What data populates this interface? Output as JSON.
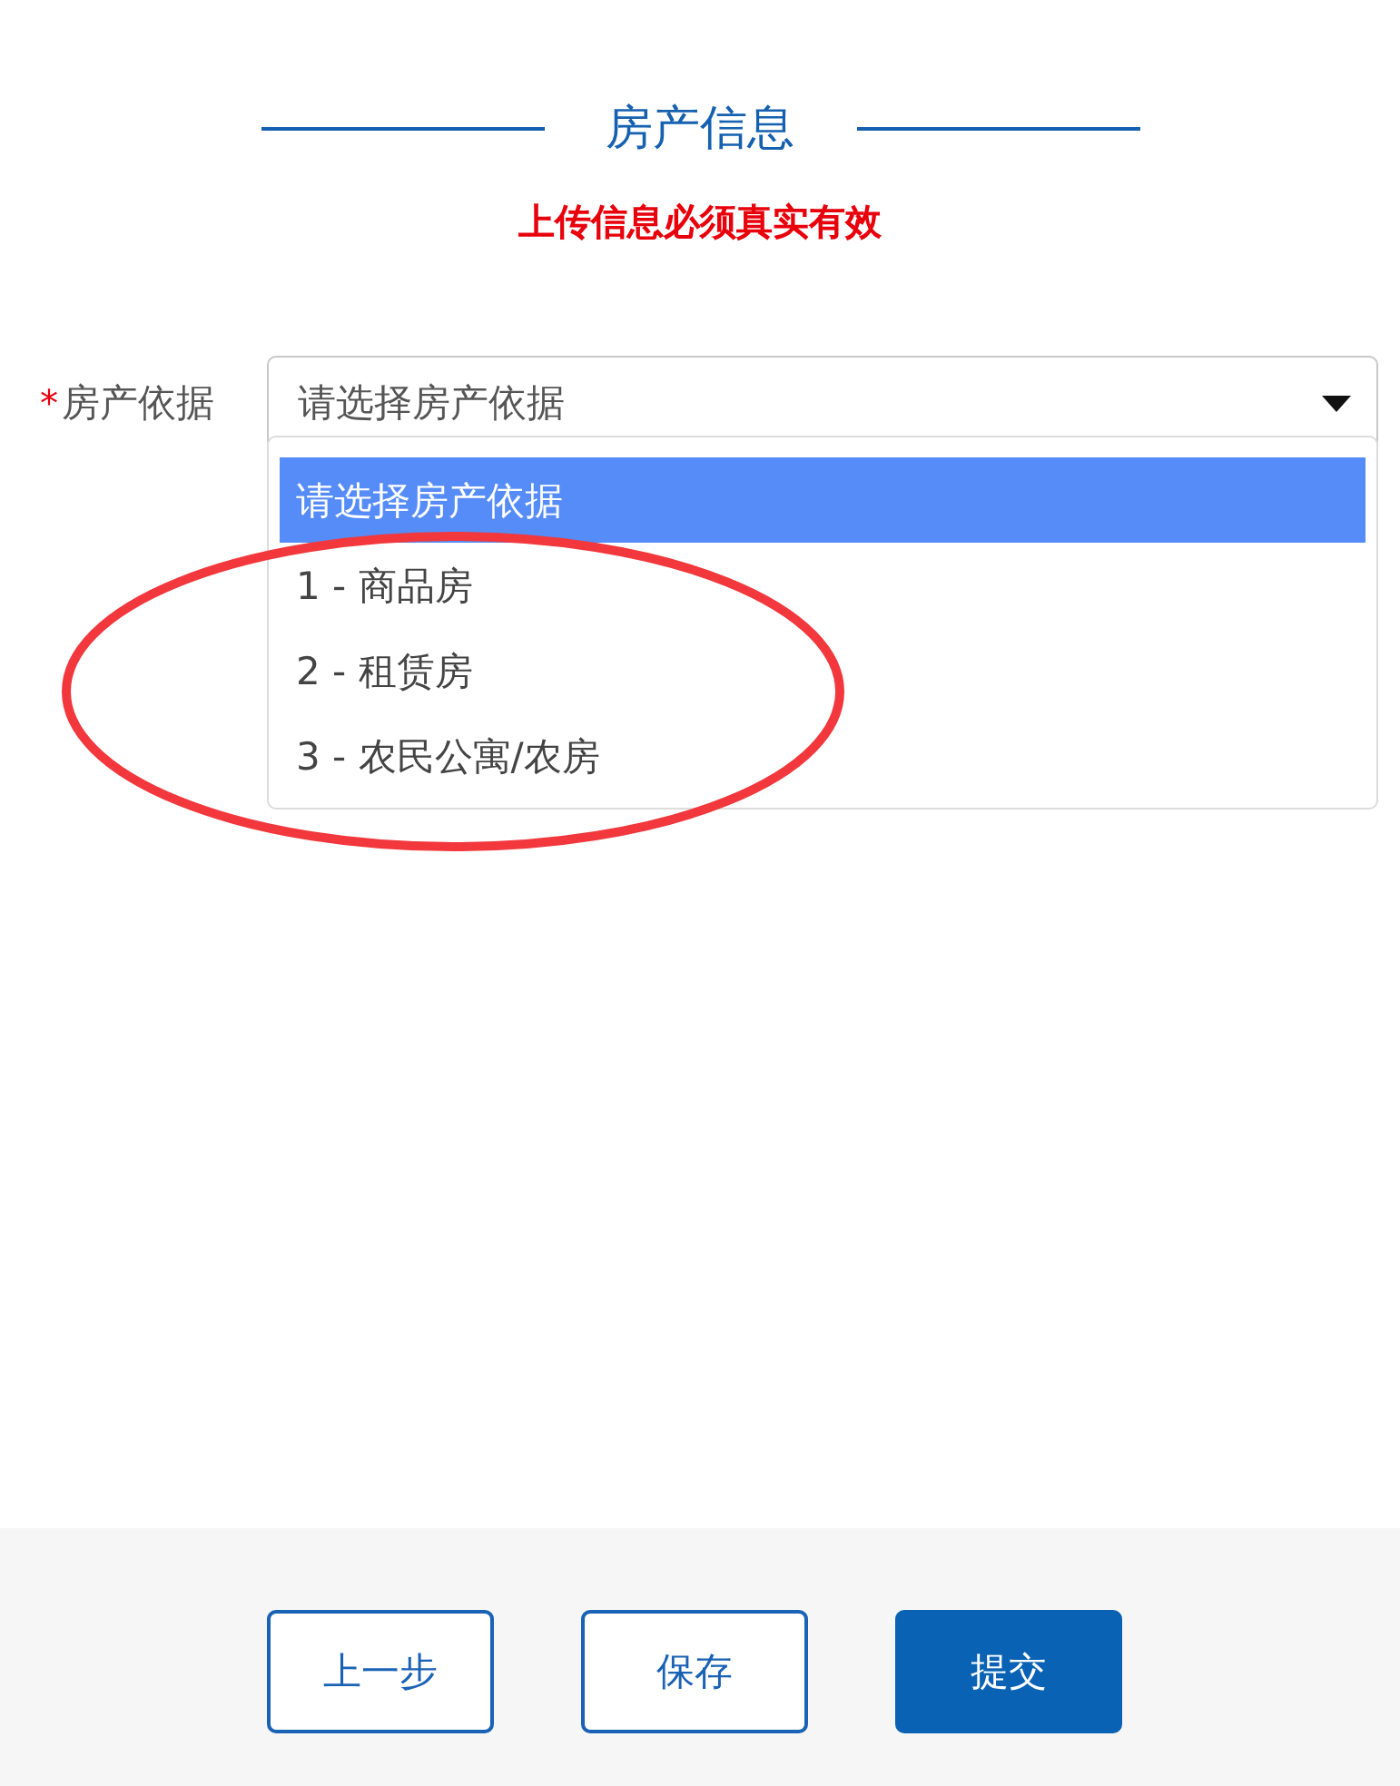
{
  "section": {
    "title": "房产信息",
    "notice": "上传信息必须真实有效"
  },
  "form": {
    "fields": [
      {
        "label": "房产依据",
        "required_mark": "*",
        "value": "请选择房产依据",
        "expanded": true,
        "options": [
          {
            "label": "请选择房产依据",
            "selected": true
          },
          {
            "label": "1 - 商品房",
            "selected": false
          },
          {
            "label": "2 - 租赁房",
            "selected": false
          },
          {
            "label": "3 - 农民公寓/农房",
            "selected": false
          }
        ]
      }
    ]
  },
  "annotation": {
    "kind": "ellipse"
  },
  "buttons": [
    {
      "label": "上一步",
      "kind": "outline"
    },
    {
      "label": "保存",
      "kind": "outline"
    },
    {
      "label": "提交",
      "kind": "primary"
    }
  ]
}
